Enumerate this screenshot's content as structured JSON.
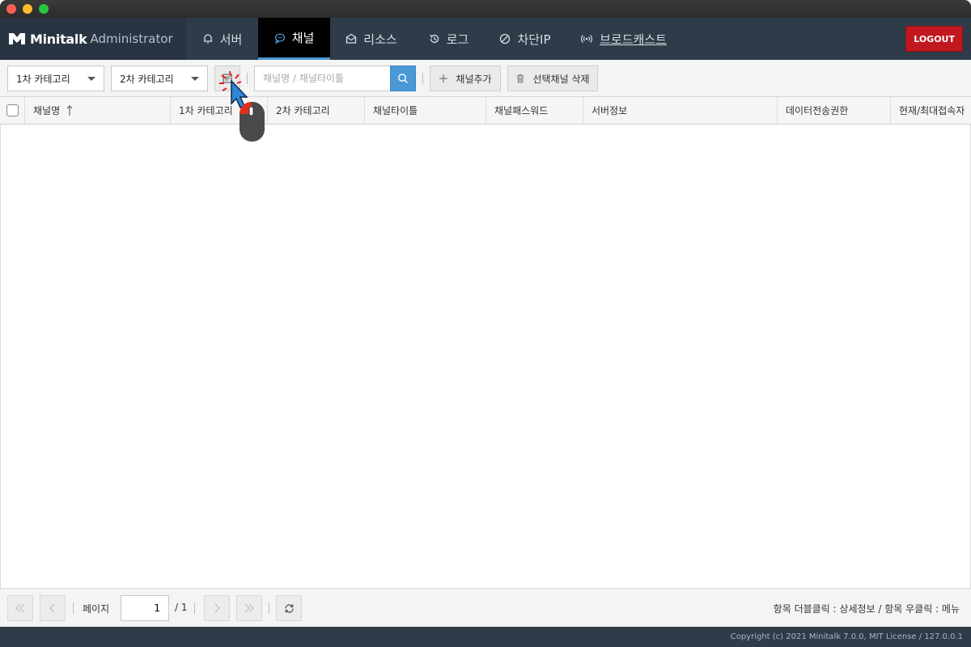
{
  "window": {
    "controls": [
      "close",
      "minimize",
      "zoom"
    ]
  },
  "brand": {
    "name": "Minitalk",
    "subtitle": "Administrator",
    "logo_icon": "minitalk-logo-icon"
  },
  "nav": {
    "tabs": [
      {
        "label": "서버",
        "icon": "bell-icon"
      },
      {
        "label": "채널",
        "icon": "chat-bubble-icon",
        "active": true
      },
      {
        "label": "리소스",
        "icon": "mail-icon"
      },
      {
        "label": "로그",
        "icon": "history-icon"
      },
      {
        "label": "차단IP",
        "icon": "ban-icon"
      },
      {
        "label": "브로드캐스트",
        "icon": "broadcast-icon"
      }
    ],
    "logout_label": "LOGOUT"
  },
  "toolbar": {
    "category1": "1차 카테고리",
    "category2": "2차 카테고리",
    "manage_category_icon": "category-manage-icon",
    "search_placeholder": "채널명 / 채널타이틀",
    "search_icon": "search-icon",
    "add_channel_label": "채널추가",
    "delete_selected_label": "선택채널 삭제"
  },
  "grid": {
    "columns": [
      {
        "label": "채널명",
        "sorted": "asc"
      },
      {
        "label": "1차 카테고리"
      },
      {
        "label": "2차 카테고리"
      },
      {
        "label": "채널타이틀"
      },
      {
        "label": "채널패스워드"
      },
      {
        "label": "서버정보"
      },
      {
        "label": "데이터전송권한"
      },
      {
        "label": "현재/최대접속자"
      }
    ],
    "rows": []
  },
  "pager": {
    "page_label": "페이지",
    "current_page": "1",
    "total_pages": "/ 1",
    "hint": "항목 더블클릭 : 상세정보 / 항목 우클릭 : 메뉴"
  },
  "status": {
    "copyright": "Copyright (c) 2021 Minitalk 7.0.0, MIT License / 127.0.0.1"
  },
  "colors": {
    "navbar": "#2e3b49",
    "active_tab": "#000000",
    "active_underline": "#4a98d6",
    "logout": "#c0181e",
    "search_button": "#4a98d6"
  }
}
